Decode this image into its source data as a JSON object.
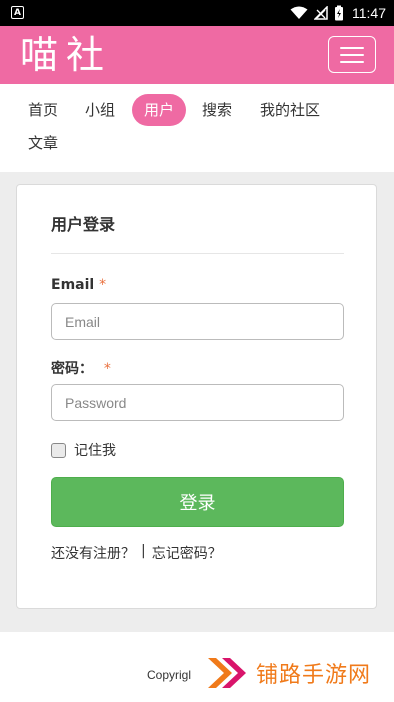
{
  "status_bar": {
    "time": "11:47",
    "left_icon_letter": "A"
  },
  "header": {
    "logo": "喵社",
    "menu_icon": "hamburger-menu-icon",
    "brand_color": "#ef6aa3"
  },
  "nav": {
    "items": [
      {
        "label": "首页",
        "active": false
      },
      {
        "label": "小组",
        "active": false
      },
      {
        "label": "用户",
        "active": true
      },
      {
        "label": "搜索",
        "active": false
      },
      {
        "label": "我的社区",
        "active": false
      },
      {
        "label": "文章",
        "active": false
      }
    ]
  },
  "login": {
    "title": "用户登录",
    "email_label": "Email",
    "email_placeholder": "Email",
    "password_label": "密码：",
    "password_placeholder": "Password",
    "required_mark": "*",
    "remember_label": "记住我",
    "remember_checked": false,
    "submit_label": "登录",
    "submit_color": "#5cb85c",
    "register_link": "还没有注册？",
    "separator": "|",
    "forgot_link": "忘记密码？"
  },
  "footer": {
    "copyright": "Copyrigl",
    "watermark_text": "铺路手游网",
    "watermark_color": "#f07a1a"
  }
}
